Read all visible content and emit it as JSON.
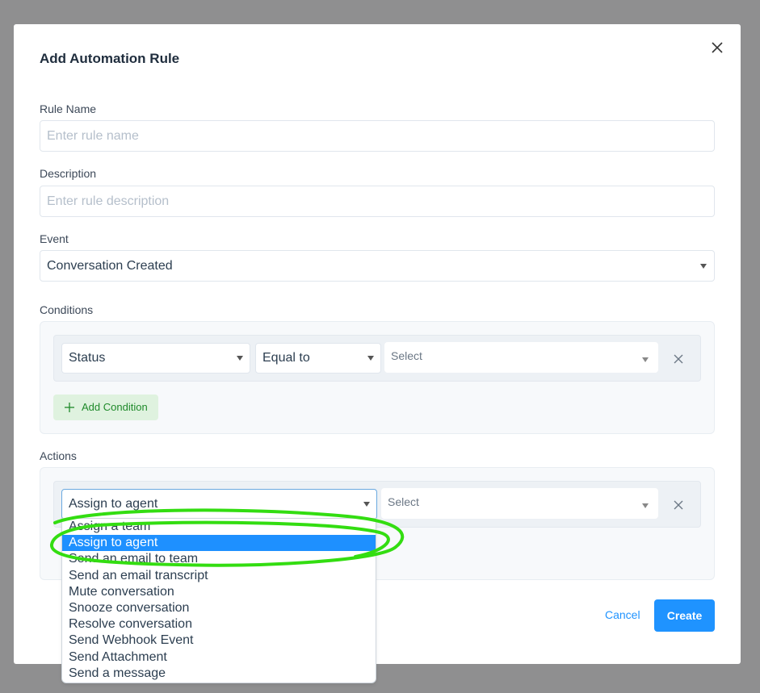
{
  "modal": {
    "title": "Add Automation Rule",
    "rule_name": {
      "label": "Rule Name",
      "placeholder": "Enter rule name",
      "value": ""
    },
    "description": {
      "label": "Description",
      "placeholder": "Enter rule description",
      "value": ""
    },
    "event": {
      "label": "Event",
      "value": "Conversation Created"
    },
    "conditions": {
      "label": "Conditions",
      "row": {
        "attribute": "Status",
        "operator": "Equal to",
        "value_placeholder": "Select"
      },
      "add_label": "Add Condition"
    },
    "actions": {
      "label": "Actions",
      "row": {
        "action": "Assign to agent",
        "value_placeholder": "Select"
      },
      "options": [
        "Assign a team",
        "Assign to agent",
        "Send an email to team",
        "Send an email transcript",
        "Mute conversation",
        "Snooze conversation",
        "Resolve conversation",
        "Send Webhook Event",
        "Send Attachment",
        "Send a message"
      ],
      "selected_option": "Assign to agent"
    },
    "buttons": {
      "cancel": "Cancel",
      "create": "Create"
    }
  },
  "colors": {
    "primary": "#1f93ff",
    "highlight": "#1e90ff",
    "success": "#1f8a2a",
    "annotation": "#33dd11",
    "overlay": "#8f8f90"
  },
  "icons": [
    "close-icon",
    "caret-down-icon",
    "plus-icon"
  ]
}
